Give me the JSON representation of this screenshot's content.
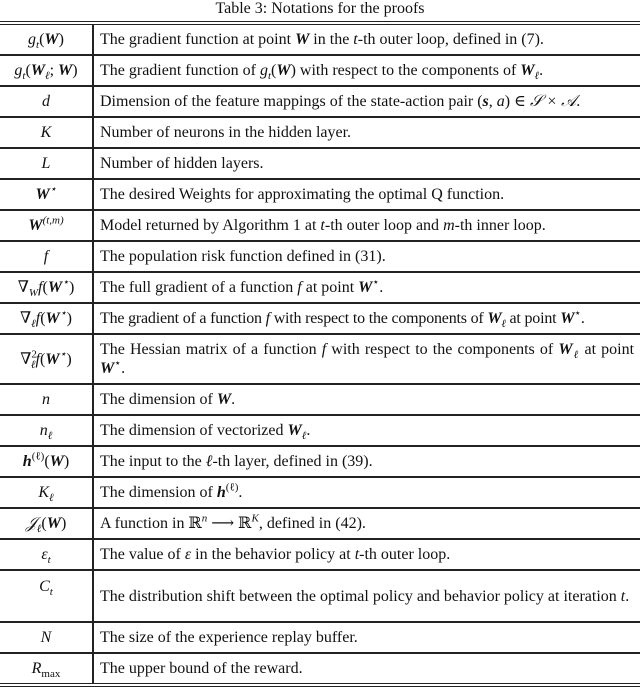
{
  "caption": "Table 3: Notations for the proofs",
  "rows": [
    {
      "symbol": "g_t(W)",
      "description": "The gradient function at point W in the t-th outer loop, defined in (7)."
    },
    {
      "symbol": "g_t(W_ℓ; W)",
      "description": "The gradient function of g_t(W) with respect to the components of W_ℓ."
    },
    {
      "symbol": "d",
      "description": "Dimension of the feature mappings of the state-action pair (s, a) ∈ 𝒮 × 𝒜."
    },
    {
      "symbol": "K",
      "description": "Number of neurons in the hidden layer."
    },
    {
      "symbol": "L",
      "description": "Number of hidden layers."
    },
    {
      "symbol": "W*",
      "description": "The desired Weights for approximating the optimal Q function."
    },
    {
      "symbol": "W^(t,m)",
      "description": "Model returned by Algorithm 1 at t-th outer loop and m-th inner loop."
    },
    {
      "symbol": "f",
      "description": "The population risk function defined in (31)."
    },
    {
      "symbol": "∇_W f(W*)",
      "description": "The full gradient of a function f at point W*."
    },
    {
      "symbol": "∇_ℓ f(W*)",
      "description": "The gradient of a function f with respect to the components of W_ℓ at point W*."
    },
    {
      "symbol": "∇²_ℓ f(W*)",
      "description": "The Hessian matrix of a function f with respect to the components of W_ℓ at point W*."
    },
    {
      "symbol": "n",
      "description": "The dimension of W."
    },
    {
      "symbol": "n_ℓ",
      "description": "The dimension of vectorized W_ℓ."
    },
    {
      "symbol": "h^(ℓ)(W)",
      "description": "The input to the ℓ-th layer, defined in (39)."
    },
    {
      "symbol": "K_ℓ",
      "description": "The dimension of h^(ℓ)."
    },
    {
      "symbol": "𝒥_ℓ(W)",
      "description": "A function in ℝ^n ⟶ ℝ^K, defined in (42)."
    },
    {
      "symbol": "ε_t",
      "description": "The value of ε in the behavior policy at t-th outer loop."
    },
    {
      "symbol": "C_t",
      "description": "The distribution shift between the optimal policy and behavior policy at iteration t."
    },
    {
      "symbol": "N",
      "description": "The size of the experience replay buffer."
    },
    {
      "symbol": "R_max",
      "description": "The upper bound of the reward."
    }
  ],
  "parts": {
    "sub_t": "t",
    "sub_l": "ℓ",
    "sub_W": "W",
    "sub_max": "max",
    "sup_star": "⋆",
    "sup_tm": "(t,m)",
    "sup_l": "(ℓ)",
    "sup_2": "2",
    "sup_n": "n",
    "sup_K": "K",
    "g": "g",
    "W": "W",
    "h": "h",
    "d": "d",
    "K": "K",
    "L": "L",
    "f": "f",
    "n": "n",
    "N": "N",
    "C": "C",
    "R": "R",
    "J": "𝒥",
    "eps": "ε",
    "nabla": "∇",
    "lp": "(",
    "rp": ")",
    "semi": "; ",
    "s": "s",
    "a": "a",
    "t": "t",
    "m": "m",
    "set": "𝒮 × 𝒜",
    "in": " ∈ ",
    "comma": ", ",
    "Rn": "ℝ",
    "arrow": " ⟶ ",
    "d_gt_1": "The gradient function at point ",
    "d_gt_2": " in the ",
    "d_gt_3": "-th outer loop, defined in (7).",
    "d_gtl_1": "The gradient function of ",
    "d_gtl_2": " with respect to the components of ",
    "dot": ".",
    "d_d_1": "Dimension of the feature mappings of the state-action pair ",
    "d_K": "Number of neurons in the hidden layer.",
    "d_L": "Number of hidden layers.",
    "d_Ws": "The desired Weights for approximating the optimal Q function.",
    "d_Wtm_1": "Model returned by Algorithm 1 at ",
    "d_Wtm_2": "-th outer loop and ",
    "d_Wtm_3": "-th inner loop.",
    "d_f": "The population risk function defined in (31).",
    "d_gf_1": "The full gradient of a function ",
    "d_gf_2": " at point ",
    "d_lf_1": "The gradient of a function ",
    "d_lf_2": " with respect to the components of ",
    "d_lf_3": " at point ",
    "d_hf_1": "The Hessian matrix of a function ",
    "d_n": "The dimension of ",
    "d_nl": "The dimension of vectorized ",
    "d_h_1": "The input to the ",
    "d_h_2": "-th layer, defined in (39).",
    "d_Kl": "The dimension of ",
    "d_J_1": "A function in ",
    "d_J_2": ", defined in (42).",
    "d_e_1": "The value of ",
    "d_e_2": " in the behavior policy at ",
    "d_e_3": "-th outer loop.",
    "d_C": "The distribution shift between the optimal policy and behavior policy at iteration ",
    "d_N": "The size of the experience replay buffer.",
    "d_R": "The upper bound of the reward."
  }
}
